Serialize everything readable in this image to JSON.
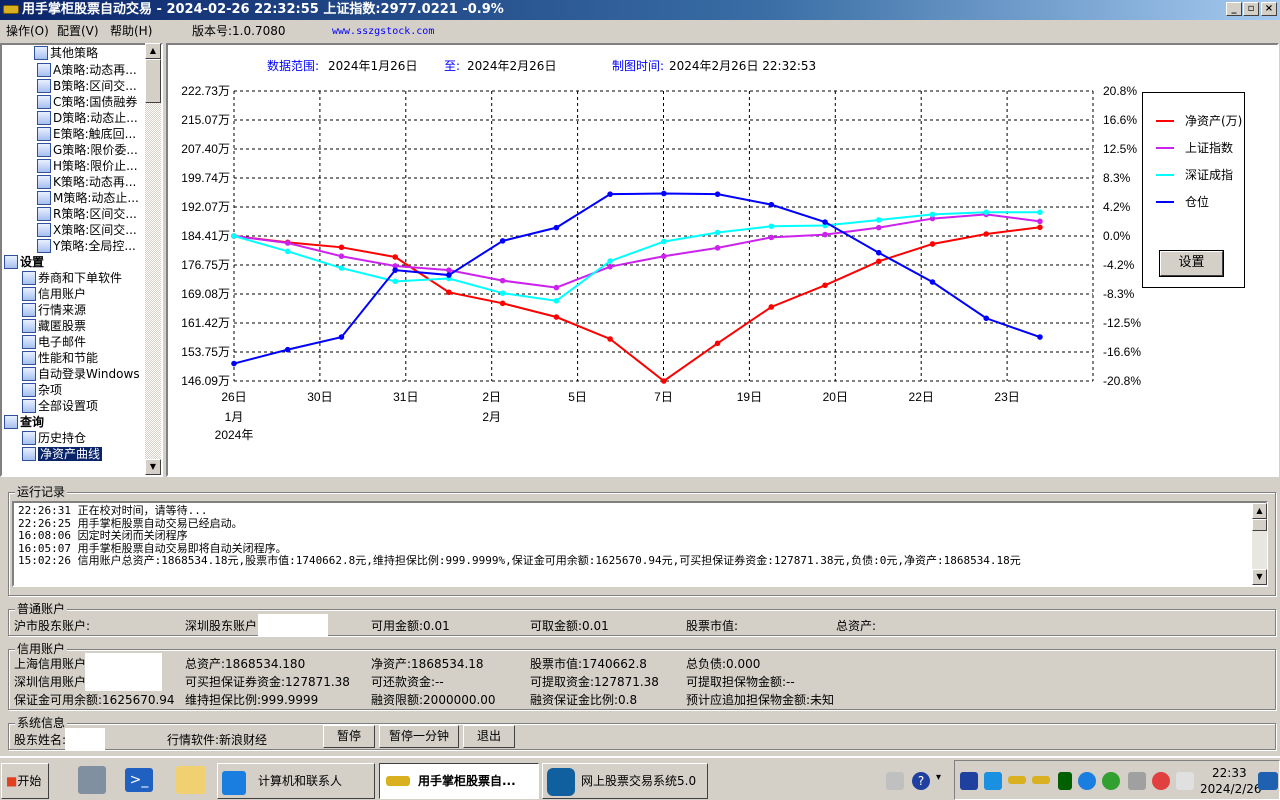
{
  "window": {
    "title": "用手掌柜股票自动交易 - 2024-02-26 22:32:55 上证指数:2977.0221 -0.9%",
    "buttons": [
      "minimize",
      "maximize",
      "close"
    ]
  },
  "menu": {
    "items": [
      "操作(O)",
      "配置(V)",
      "帮助(H)"
    ],
    "version": "版本号:1.0.7080",
    "website": "www.sszgstock.com"
  },
  "tree": {
    "strategy_group": "其他策略",
    "strategies": [
      "A策略:动态再...",
      "B策略:区间交...",
      "C策略:国债融券",
      "D策略:动态止...",
      "E策略:触底回...",
      "G策略:限价委...",
      "H策略:限价止...",
      "K策略:动态再...",
      "M策略:动态止...",
      "R策略:区间交...",
      "X策略:区间交...",
      "Y策略:全局控..."
    ],
    "settings_group": "设置",
    "settings": [
      "券商和下单软件",
      "信用账户",
      "行情来源",
      "藏匿股票",
      "电子邮件",
      "性能和节能",
      "自动登录Windows",
      "杂项",
      "全部设置项"
    ],
    "query_group": "查询",
    "queries": [
      "历史持仓",
      "净资产曲线"
    ],
    "selected": "净资产曲线"
  },
  "chart_header": {
    "range_label": "数据范围:",
    "range_start": "2024年1月26日",
    "to_label": "至:",
    "range_end": "2024年2月26日",
    "made_label": "制图时间:",
    "made_time": "2024年2月26日 22:32:53"
  },
  "chart_data": {
    "type": "line",
    "x_tick_labels": [
      "26日",
      "30日",
      "31日",
      "2日",
      "5日",
      "7日",
      "19日",
      "20日",
      "22日",
      "23日"
    ],
    "x_month_labels": [
      {
        "at": "26日",
        "label": "1月"
      },
      {
        "at": "2日",
        "label": "2月"
      }
    ],
    "x_year_label": "2024年",
    "left_axis": {
      "unit": "万",
      "ylim": [
        146.09,
        222.73
      ],
      "ticks": [
        "222.73万",
        "215.07万",
        "207.40万",
        "199.74万",
        "192.07万",
        "184.41万",
        "176.75万",
        "169.08万",
        "161.42万",
        "153.75万",
        "146.09万"
      ]
    },
    "right_axis": {
      "unit": "%",
      "ylim": [
        -20.8,
        20.8
      ],
      "ticks": [
        "20.8%",
        "16.6%",
        "12.5%",
        "8.3%",
        "4.2%",
        "0.0%",
        "-4.2%",
        "-8.3%",
        "-12.5%",
        "-16.6%",
        "-20.8%"
      ]
    },
    "grid": true,
    "legend_placement": "right",
    "series": [
      {
        "name": "净资产(万)",
        "color": "#ff0000",
        "axis": "left",
        "values": [
          184.41,
          182.74,
          181.42,
          178.86,
          169.53,
          166.62,
          163.0,
          157.19,
          146.09,
          156.05,
          165.65,
          171.38,
          177.72,
          182.3,
          184.94,
          186.71
        ]
      },
      {
        "name": "上证指数",
        "color": "#cc22ee",
        "axis": "right",
        "values": [
          0.0,
          -1.0,
          -2.9,
          -4.3,
          -4.9,
          -6.4,
          -7.4,
          -4.4,
          -2.9,
          -1.7,
          -0.2,
          0.2,
          1.2,
          2.5,
          3.1,
          2.1
        ]
      },
      {
        "name": "深证成指",
        "color": "#00ffff",
        "axis": "right",
        "values": [
          0.0,
          -2.2,
          -4.6,
          -6.5,
          -6.1,
          -8.2,
          -9.3,
          -3.6,
          -0.8,
          0.5,
          1.4,
          1.5,
          2.3,
          3.1,
          3.4,
          3.4
        ]
      },
      {
        "name": "仓位",
        "color": "#0000ff",
        "axis": "right",
        "values": [
          -18.3,
          -16.3,
          -14.5,
          -4.9,
          -5.6,
          -0.7,
          1.2,
          6.0,
          6.1,
          6.0,
          4.5,
          2.0,
          -2.4,
          -6.6,
          -11.8,
          -14.5
        ]
      }
    ],
    "settings_button": "设置"
  },
  "log": {
    "title": "运行记录",
    "lines": [
      "22:26:31 正在校对时间，请等待...",
      "22:26:25 用手掌柜股票自动交易已经启动。",
      "16:08:06 因定时关闭而关闭程序",
      "16:05:07 用手掌柜股票自动交易即将自动关闭程序。",
      "15:02:26 信用账户总资产:1868534.18元,股票市值:1740662.8元,维持担保比例:999.9999%,保证金可用余额:1625670.94元,可买担保证券资金:127871.38元,负债:0元,净资产:1868534.18元"
    ]
  },
  "normal_account": {
    "title": "普通账户",
    "sh_account": "沪市股东账户:",
    "sz_account": "深圳股东账户",
    "available": "可用金额:0.01",
    "withdrawable": "可取金额:0.01",
    "market_value": "股票市值:",
    "total_assets": "总资产:"
  },
  "credit_account": {
    "title": "信用账户",
    "sh_account": "上海信用账户",
    "sz_account": "深圳信用账户",
    "margin_available": "保证金可用余额:1625670.94",
    "total_assets": "总资产:1868534.180",
    "buy_collateral": "可买担保证券资金:127871.38",
    "maintain_ratio": "维持担保比例:999.9999",
    "net_assets": "净资产:1868534.18",
    "repay_funds": "可还款资金:--",
    "financing_limit": "融资限额:2000000.00",
    "market_value": "股票市值:1740662.8",
    "withdraw_funds": "可提取资金:127871.38",
    "financing_margin_ratio": "融资保证金比例:0.8",
    "total_debt": "总负债:0.000",
    "withdraw_collateral": "可提取担保物金额:--",
    "estimated_add": "预计应追加担保物金额:未知"
  },
  "system_info": {
    "title": "系统信息",
    "holder_name": "股东姓名:",
    "quote_software": "行情软件:新浪财经",
    "pause": "暂停",
    "pause_minute": "暂停一分钟",
    "exit": "退出"
  },
  "taskbar": {
    "start": "开始",
    "tasks": [
      "计算机和联系人",
      "用手掌柜股票自...",
      "网上股票交易系统5.0"
    ],
    "clock_time": "22:33",
    "clock_date": "2024/2/26"
  }
}
